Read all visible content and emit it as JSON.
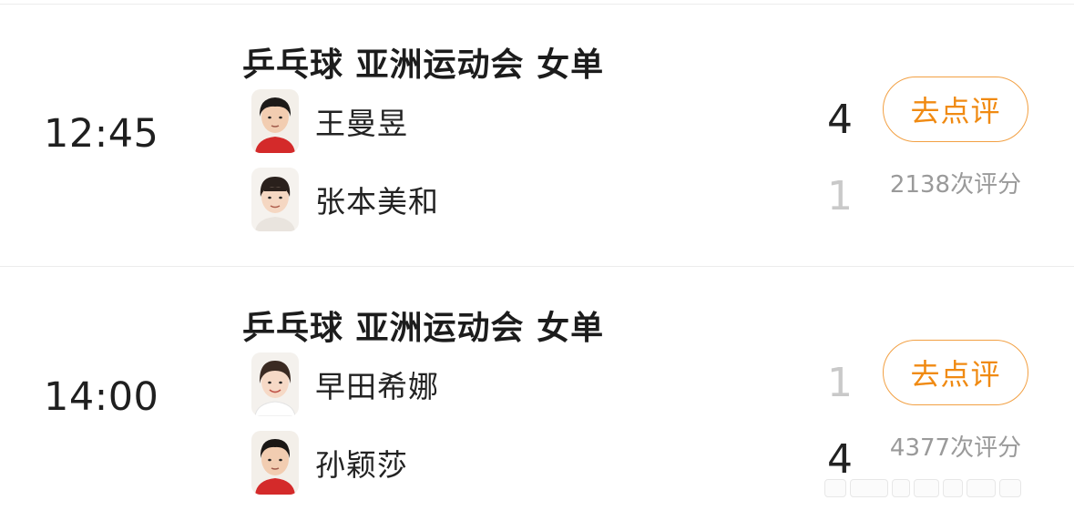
{
  "matches": [
    {
      "time": "12:45",
      "title": "乒乓球 亚洲运动会 女单",
      "players": [
        {
          "name": "王曼昱",
          "score": "4",
          "result": "win",
          "avatar_icon": "player-avatar"
        },
        {
          "name": "张本美和",
          "score": "1",
          "result": "lose",
          "avatar_icon": "player-avatar"
        }
      ],
      "rate_button": "去点评",
      "rating_count": "2138次评分"
    },
    {
      "time": "14:00",
      "title": "乒乓球 亚洲运动会 女单",
      "players": [
        {
          "name": "早田希娜",
          "score": "1",
          "result": "lose",
          "avatar_icon": "player-avatar"
        },
        {
          "name": "孙颖莎",
          "score": "4",
          "result": "win",
          "avatar_icon": "player-avatar"
        }
      ],
      "rate_button": "去点评",
      "rating_count": "4377次评分"
    }
  ],
  "colors": {
    "accent": "#f08a12",
    "accent_border": "#f2a043",
    "win_score": "#222222",
    "lose_score": "#c9c9c9",
    "muted_text": "#9a9a9a",
    "jersey_red": "#d42a2a",
    "divider": "#ececec"
  }
}
